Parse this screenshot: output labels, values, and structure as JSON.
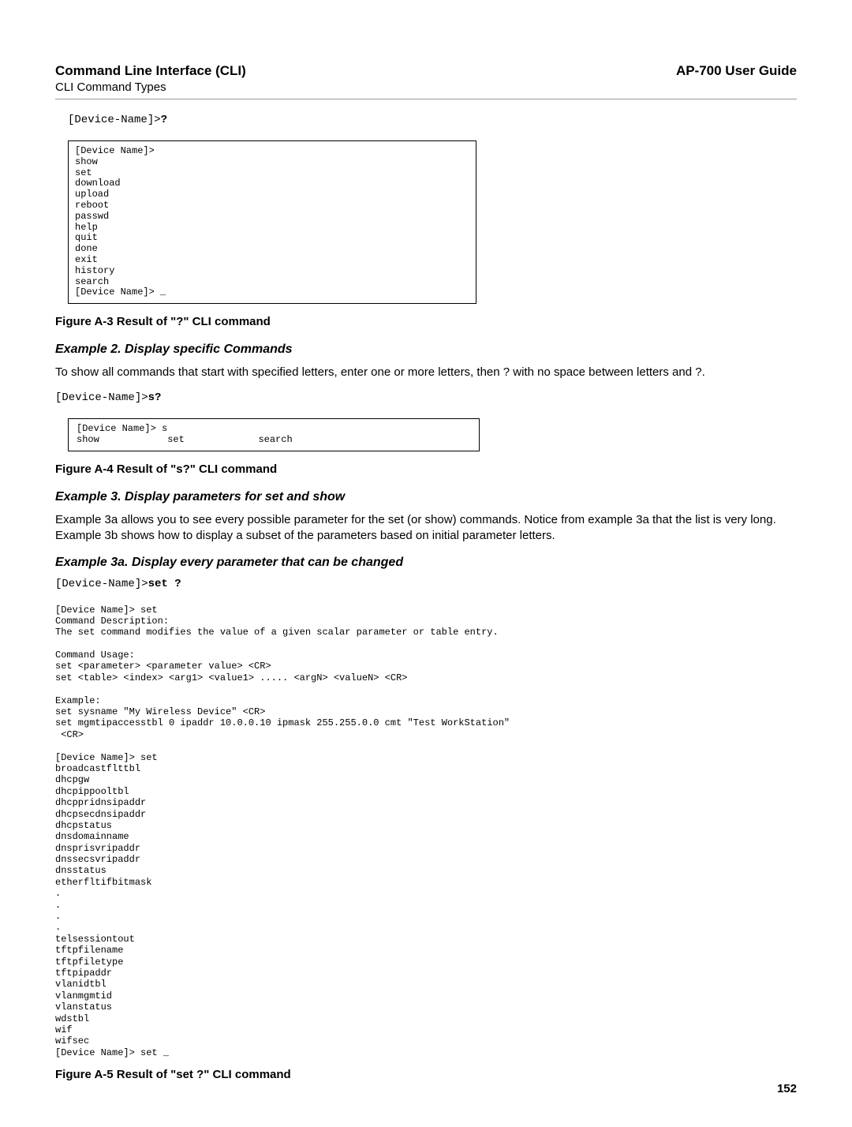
{
  "header": {
    "title": "Command Line Interface (CLI)",
    "subtitle": "CLI Command Types",
    "guide": "AP-700 User Guide"
  },
  "example1": {
    "prompt_prefix": "[Device-Name]>",
    "prompt_cmd": "?",
    "box": "[Device Name]>\nshow\nset\ndownload\nupload\nreboot\npasswd\nhelp\nquit\ndone\nexit\nhistory\nsearch\n[Device Name]> _",
    "caption": "Figure A-3 Result of \"?\" CLI command"
  },
  "example2": {
    "heading": "Example 2. Display specific Commands",
    "text": "To show all commands that start with specified letters, enter one or more letters, then ? with no space between letters and ?.",
    "prompt_prefix": "[Device-Name]>",
    "prompt_cmd": "s?",
    "box": "[Device Name]> s\nshow            set             search",
    "caption": "Figure A-4 Result of \"s?\" CLI command"
  },
  "example3": {
    "heading": "Example 3. Display parameters for set and show",
    "text": "Example 3a allows you to see every possible parameter for the set (or show) commands. Notice from example 3a that the list is very long. Example 3b shows how to display a subset of the parameters based on initial parameter letters."
  },
  "example3a": {
    "heading": "Example 3a. Display every parameter that can be changed",
    "prompt_prefix": "[Device-Name]>",
    "prompt_cmd": "set ?",
    "block": "[Device Name]> set\nCommand Description:\nThe set command modifies the value of a given scalar parameter or table entry.\n\nCommand Usage:\nset <parameter> <parameter value> <CR>\nset <table> <index> <arg1> <value1> ..... <argN> <valueN> <CR>\n\nExample:\nset sysname \"My Wireless Device\" <CR>\nset mgmtipaccesstbl 0 ipaddr 10.0.0.10 ipmask 255.255.0.0 cmt \"Test WorkStation\"\n <CR>\n\n[Device Name]> set\nbroadcastflttbl\ndhcpgw\ndhcpippooltbl\ndhcppridnsipaddr\ndhcpsecdnsipaddr\ndhcpstatus\ndnsdomainname\ndnsprisvripaddr\ndnssecsvripaddr\ndnsstatus\netherfltifbitmask\n.\n.\n.\n.\ntelsessiontout\ntftpfilename\ntftpfiletype\ntftpipaddr\nvlanidtbl\nvlanmgmtid\nvlanstatus\nwdstbl\nwif\nwifsec\n[Device Name]> set _",
    "caption": "Figure A-5 Result of \"set ?\" CLI command"
  },
  "pageNumber": "152"
}
